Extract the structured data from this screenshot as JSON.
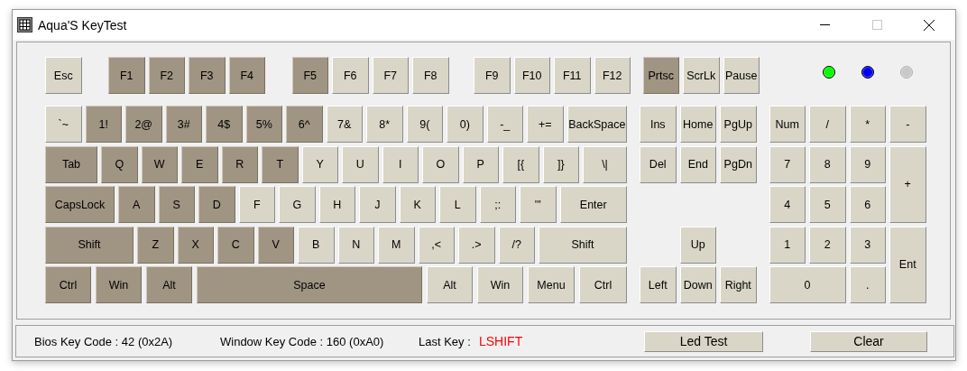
{
  "window": {
    "title": "Aqua'S KeyTest"
  },
  "keyboard": {
    "function_keys": [
      {
        "label": "Esc",
        "pressed": false
      },
      {
        "label": "F1",
        "pressed": true
      },
      {
        "label": "F2",
        "pressed": true
      },
      {
        "label": "F3",
        "pressed": true
      },
      {
        "label": "F4",
        "pressed": true
      },
      {
        "label": "F5",
        "pressed": true
      },
      {
        "label": "F6",
        "pressed": false
      },
      {
        "label": "F7",
        "pressed": false
      },
      {
        "label": "F8",
        "pressed": false
      },
      {
        "label": "F9",
        "pressed": false
      },
      {
        "label": "F10",
        "pressed": false
      },
      {
        "label": "F11",
        "pressed": false
      },
      {
        "label": "F12",
        "pressed": false
      },
      {
        "label": "Prtsc",
        "pressed": true
      },
      {
        "label": "ScrLk",
        "pressed": false
      },
      {
        "label": "Pause",
        "pressed": false
      }
    ],
    "leds": [
      {
        "color": "#00ff00",
        "on": true
      },
      {
        "color": "#0000ff",
        "on": true
      },
      {
        "color": "#c8c8c8",
        "on": false
      }
    ],
    "main_rows": [
      {
        "keys": [
          {
            "label": "`~",
            "pressed": false
          },
          {
            "label": "1!",
            "pressed": true
          },
          {
            "label": "2@",
            "pressed": true
          },
          {
            "label": "3#",
            "pressed": true
          },
          {
            "label": "4$",
            "pressed": true
          },
          {
            "label": "5%",
            "pressed": true
          },
          {
            "label": "6^",
            "pressed": true
          },
          {
            "label": "7&",
            "pressed": false
          },
          {
            "label": "8*",
            "pressed": false
          },
          {
            "label": "9(",
            "pressed": false
          },
          {
            "label": "0)",
            "pressed": false
          },
          {
            "label": "-_",
            "pressed": false
          },
          {
            "label": "+=",
            "pressed": false
          },
          {
            "label": "BackSpace",
            "pressed": false
          }
        ]
      },
      {
        "keys": [
          {
            "label": "Tab",
            "pressed": true
          },
          {
            "label": "Q",
            "pressed": true
          },
          {
            "label": "W",
            "pressed": true
          },
          {
            "label": "E",
            "pressed": true
          },
          {
            "label": "R",
            "pressed": true
          },
          {
            "label": "T",
            "pressed": true
          },
          {
            "label": "Y",
            "pressed": false
          },
          {
            "label": "U",
            "pressed": false
          },
          {
            "label": "I",
            "pressed": false
          },
          {
            "label": "O",
            "pressed": false
          },
          {
            "label": "P",
            "pressed": false
          },
          {
            "label": "[{",
            "pressed": false
          },
          {
            "label": "]}",
            "pressed": false
          },
          {
            "label": "\\|",
            "pressed": false
          }
        ]
      },
      {
        "keys": [
          {
            "label": "CapsLock",
            "pressed": true
          },
          {
            "label": "A",
            "pressed": true
          },
          {
            "label": "S",
            "pressed": true
          },
          {
            "label": "D",
            "pressed": true
          },
          {
            "label": "F",
            "pressed": false
          },
          {
            "label": "G",
            "pressed": false
          },
          {
            "label": "H",
            "pressed": false
          },
          {
            "label": "J",
            "pressed": false
          },
          {
            "label": "K",
            "pressed": false
          },
          {
            "label": "L",
            "pressed": false
          },
          {
            "label": ";:",
            "pressed": false
          },
          {
            "label": "'\"",
            "pressed": false
          },
          {
            "label": "Enter",
            "pressed": false
          }
        ]
      },
      {
        "keys": [
          {
            "label": "Shift",
            "pressed": true
          },
          {
            "label": "Z",
            "pressed": true
          },
          {
            "label": "X",
            "pressed": true
          },
          {
            "label": "C",
            "pressed": true
          },
          {
            "label": "V",
            "pressed": true
          },
          {
            "label": "B",
            "pressed": false
          },
          {
            "label": "N",
            "pressed": false
          },
          {
            "label": "M",
            "pressed": false
          },
          {
            "label": ",<",
            "pressed": false
          },
          {
            "label": ".>",
            "pressed": false
          },
          {
            "label": "/?",
            "pressed": false
          },
          {
            "label": "Shift",
            "pressed": false
          }
        ]
      },
      {
        "keys": [
          {
            "label": "Ctrl",
            "pressed": true
          },
          {
            "label": "Win",
            "pressed": true
          },
          {
            "label": "Alt",
            "pressed": true
          },
          {
            "label": "Space",
            "pressed": true
          },
          {
            "label": "Alt",
            "pressed": false
          },
          {
            "label": "Win",
            "pressed": false
          },
          {
            "label": "Menu",
            "pressed": false
          },
          {
            "label": "Ctrl",
            "pressed": false
          }
        ]
      }
    ],
    "navigation_keys": [
      {
        "label": "Ins",
        "pressed": false
      },
      {
        "label": "Home",
        "pressed": false
      },
      {
        "label": "PgUp",
        "pressed": false
      },
      {
        "label": "Del",
        "pressed": false
      },
      {
        "label": "End",
        "pressed": false
      },
      {
        "label": "PgDn",
        "pressed": false
      },
      {
        "label": "Up",
        "pressed": false
      },
      {
        "label": "Left",
        "pressed": false
      },
      {
        "label": "Down",
        "pressed": false
      },
      {
        "label": "Right",
        "pressed": false
      }
    ],
    "numpad_keys": [
      {
        "label": "Num",
        "pressed": false
      },
      {
        "label": "/",
        "pressed": false
      },
      {
        "label": "*",
        "pressed": false
      },
      {
        "label": "-",
        "pressed": false
      },
      {
        "label": "7",
        "pressed": false
      },
      {
        "label": "8",
        "pressed": false
      },
      {
        "label": "9",
        "pressed": false
      },
      {
        "label": "+",
        "pressed": false
      },
      {
        "label": "4",
        "pressed": false
      },
      {
        "label": "5",
        "pressed": false
      },
      {
        "label": "6",
        "pressed": false
      },
      {
        "label": "1",
        "pressed": false
      },
      {
        "label": "2",
        "pressed": false
      },
      {
        "label": "3",
        "pressed": false
      },
      {
        "label": "Ent",
        "pressed": false
      },
      {
        "label": "0",
        "pressed": false
      },
      {
        "label": ".",
        "pressed": false
      }
    ]
  },
  "status_bar": {
    "bios_key_code": "Bios Key Code : 42 (0x2A)",
    "window_key_code": "Window Key Code : 160 (0xA0)",
    "last_key_label": "Last Key :",
    "last_key": "LSHIFT",
    "buttons": [
      {
        "label": "Led Test"
      },
      {
        "label": "Clear"
      }
    ]
  }
}
